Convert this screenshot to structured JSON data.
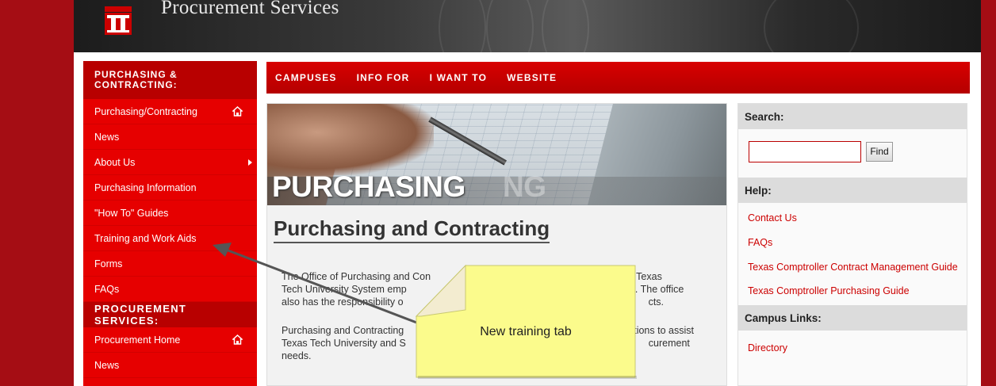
{
  "header": {
    "site_title": "Procurement Services",
    "logo_icon": "double-t-logo"
  },
  "left_nav": {
    "section1_title": "PURCHASING & CONTRACTING:",
    "section1_items": [
      {
        "label": "Purchasing/Contracting",
        "icon": "home-icon"
      },
      {
        "label": "News"
      },
      {
        "label": "About Us",
        "icon": "arrow-right-icon"
      },
      {
        "label": "Purchasing Information"
      },
      {
        "label": "\"How To\" Guides"
      },
      {
        "label": "Training and Work Aids"
      },
      {
        "label": "Forms"
      },
      {
        "label": "FAQs"
      }
    ],
    "section2_title": "PROCUREMENT SERVICES:",
    "section2_items": [
      {
        "label": "Procurement Home",
        "icon": "home-icon"
      },
      {
        "label": "News"
      }
    ]
  },
  "top_nav": [
    "CAMPUSES",
    "INFO FOR",
    "I WANT TO",
    "WEBSITE"
  ],
  "main": {
    "banner_word": "PURCHASING",
    "banner_ghost": "NG",
    "title": "Purchasing and Contracting",
    "para1_line1_a": "The Office of Purchasing and Con",
    "para1_line1_b": "and Texas",
    "para1_line2_a": "Tech University System emp",
    "para1_line2_b": "ices. The office",
    "para1_line3_a": "also has the responsibility o",
    "para1_line3_b": "cts.",
    "para2_line1_a": "Purchasing and Contracting",
    "para2_line1_b": "utions to assist",
    "para2_line2_a": "Texas Tech University and S",
    "para2_line2_b": "curement",
    "para2_line3": "needs."
  },
  "right": {
    "search_title": "Search:",
    "search_value": "",
    "find_label": "Find",
    "help_title": "Help:",
    "help_links": [
      "Contact Us",
      "FAQs",
      "Texas Comptroller Contract Management Guide",
      "Texas Comptroller Purchasing Guide"
    ],
    "campus_title": "Campus Links:",
    "campus_links": [
      "Directory"
    ]
  },
  "callout": {
    "text": "New training tab"
  },
  "colors": {
    "brand_red": "#e60000",
    "dark_red": "#b80000",
    "frame_red": "#a50d14",
    "callout_yellow": "#fbfb8c"
  }
}
